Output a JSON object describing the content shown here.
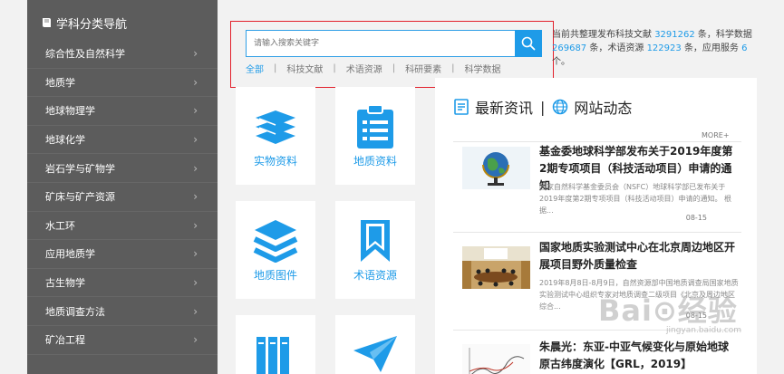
{
  "sidebar": {
    "title": "学科分类导航",
    "items": [
      {
        "label": "综合性及自然科学"
      },
      {
        "label": "地质学"
      },
      {
        "label": "地球物理学"
      },
      {
        "label": "地球化学"
      },
      {
        "label": "岩石学与矿物学"
      },
      {
        "label": "矿床与矿产资源"
      },
      {
        "label": "水工环"
      },
      {
        "label": "应用地质学"
      },
      {
        "label": "古生物学"
      },
      {
        "label": "地质调查方法"
      },
      {
        "label": "矿冶工程"
      }
    ],
    "chevron": "›"
  },
  "search": {
    "placeholder": "请输入搜索关键字",
    "categories": [
      "全部",
      "科技文献",
      "术语资源",
      "科研要素",
      "科学数据"
    ],
    "separator": "|"
  },
  "stats": {
    "p1": "当前共整理发布科技文献",
    "docs": "3291262",
    "p2": "条，科学数据",
    "data": "269687",
    "p3": "条，术语资源",
    "terms": "122923",
    "p4": "条，应用服务",
    "services": "6",
    "p5": "个。"
  },
  "tiles": [
    {
      "label": "实物资料",
      "icon": "books-stack-icon"
    },
    {
      "label": "地质资料",
      "icon": "clipboard-list-icon"
    },
    {
      "label": "地质图件",
      "icon": "layers-icon"
    },
    {
      "label": "术语资源",
      "icon": "bookmark-icon"
    },
    {
      "label": "",
      "icon": "book-shelf-icon"
    },
    {
      "label": "",
      "icon": "paper-plane-icon"
    }
  ],
  "news": {
    "tab_latest": "最新资讯",
    "tab_site": "网站动态",
    "divider": "|",
    "more": "MORE+",
    "items": [
      {
        "title": "基金委地球科学部发布关于2019年度第2期专项项目（科技活动项目）申请的通知",
        "excerpt": "国家自然科学基金委员会（NSFC）地球科学部已发布关于2019年度第2期专项项目（科技活动项目）申请的通知。 根据...",
        "date": "08-15",
        "thumb": "globe-image"
      },
      {
        "title": "国家地质实验测试中心在北京周边地区开展项目野外质量检查",
        "excerpt": "2019年8月8日-8月9日，自然资源部中国地质调查局国家地质实验测试中心组织专家对地质调查二级项目《北京及周边地区综合...",
        "date": "08-15",
        "thumb": "meeting-room-image"
      },
      {
        "title": "朱晨光：东亚-中亚气候变化与原始地球原古纬度演化【GRL，2019】",
        "excerpt": "",
        "date": "",
        "thumb": "chart-figure-image"
      }
    ]
  },
  "watermark": {
    "text": "Bai⊙经验",
    "sub": "jingyan.baidu.com"
  },
  "colors": {
    "accent": "#1e9be8",
    "sidebar_bg": "#5c5c5c",
    "highlight_box": "#e2202b"
  }
}
